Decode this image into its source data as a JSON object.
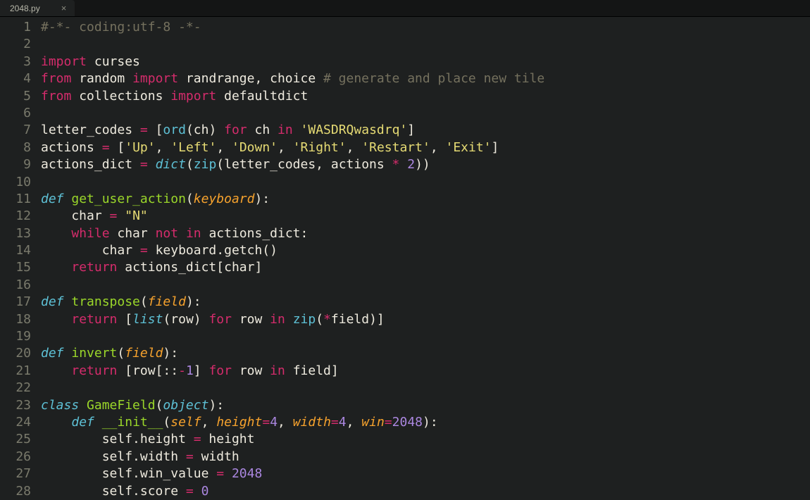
{
  "tab": {
    "filename": "2048.py",
    "close_glyph": "×"
  },
  "gutter": [
    "1",
    "2",
    "3",
    "4",
    "5",
    "6",
    "7",
    "8",
    "9",
    "10",
    "11",
    "12",
    "13",
    "14",
    "15",
    "16",
    "17",
    "18",
    "19",
    "20",
    "21",
    "22",
    "23",
    "24",
    "25",
    "26",
    "27",
    "28"
  ],
  "code": [
    [
      {
        "t": "#-*- coding:utf-8 -*-",
        "c": "c-comment"
      }
    ],
    [],
    [
      {
        "t": "import",
        "c": "c-keyword"
      },
      {
        "t": " curses",
        "c": "c-default"
      }
    ],
    [
      {
        "t": "from",
        "c": "c-keyword"
      },
      {
        "t": " random ",
        "c": "c-default"
      },
      {
        "t": "import",
        "c": "c-keyword"
      },
      {
        "t": " randrange, choice ",
        "c": "c-default"
      },
      {
        "t": "# generate and place new tile",
        "c": "c-comment"
      }
    ],
    [
      {
        "t": "from",
        "c": "c-keyword"
      },
      {
        "t": " collections ",
        "c": "c-default"
      },
      {
        "t": "import",
        "c": "c-keyword"
      },
      {
        "t": " defaultdict",
        "c": "c-default"
      }
    ],
    [],
    [
      {
        "t": "letter_codes ",
        "c": "c-default"
      },
      {
        "t": "=",
        "c": "c-op"
      },
      {
        "t": " [",
        "c": "c-default"
      },
      {
        "t": "ord",
        "c": "c-builtin"
      },
      {
        "t": "(ch) ",
        "c": "c-default"
      },
      {
        "t": "for",
        "c": "c-keyword"
      },
      {
        "t": " ch ",
        "c": "c-default"
      },
      {
        "t": "in",
        "c": "c-keyword"
      },
      {
        "t": " ",
        "c": "c-default"
      },
      {
        "t": "'WASDRQwasdrq'",
        "c": "c-string"
      },
      {
        "t": "]",
        "c": "c-default"
      }
    ],
    [
      {
        "t": "actions ",
        "c": "c-default"
      },
      {
        "t": "=",
        "c": "c-op"
      },
      {
        "t": " [",
        "c": "c-default"
      },
      {
        "t": "'Up'",
        "c": "c-string"
      },
      {
        "t": ", ",
        "c": "c-default"
      },
      {
        "t": "'Left'",
        "c": "c-string"
      },
      {
        "t": ", ",
        "c": "c-default"
      },
      {
        "t": "'Down'",
        "c": "c-string"
      },
      {
        "t": ", ",
        "c": "c-default"
      },
      {
        "t": "'Right'",
        "c": "c-string"
      },
      {
        "t": ", ",
        "c": "c-default"
      },
      {
        "t": "'Restart'",
        "c": "c-string"
      },
      {
        "t": ", ",
        "c": "c-default"
      },
      {
        "t": "'Exit'",
        "c": "c-string"
      },
      {
        "t": "]",
        "c": "c-default"
      }
    ],
    [
      {
        "t": "actions_dict ",
        "c": "c-default"
      },
      {
        "t": "=",
        "c": "c-op"
      },
      {
        "t": " ",
        "c": "c-default"
      },
      {
        "t": "dict",
        "c": "c-storage"
      },
      {
        "t": "(",
        "c": "c-default"
      },
      {
        "t": "zip",
        "c": "c-builtin"
      },
      {
        "t": "(letter_codes, actions ",
        "c": "c-default"
      },
      {
        "t": "*",
        "c": "c-op"
      },
      {
        "t": " ",
        "c": "c-default"
      },
      {
        "t": "2",
        "c": "c-number"
      },
      {
        "t": "))",
        "c": "c-default"
      }
    ],
    [],
    [
      {
        "t": "def",
        "c": "c-storage"
      },
      {
        "t": " ",
        "c": "c-default"
      },
      {
        "t": "get_user_action",
        "c": "c-name"
      },
      {
        "t": "(",
        "c": "c-default"
      },
      {
        "t": "keyboard",
        "c": "c-param"
      },
      {
        "t": "):",
        "c": "c-default"
      }
    ],
    [
      {
        "t": "    char ",
        "c": "c-default"
      },
      {
        "t": "=",
        "c": "c-op"
      },
      {
        "t": " ",
        "c": "c-default"
      },
      {
        "t": "\"N\"",
        "c": "c-string"
      }
    ],
    [
      {
        "t": "    ",
        "c": "c-default"
      },
      {
        "t": "while",
        "c": "c-keyword"
      },
      {
        "t": " char ",
        "c": "c-default"
      },
      {
        "t": "not",
        "c": "c-keyword"
      },
      {
        "t": " ",
        "c": "c-default"
      },
      {
        "t": "in",
        "c": "c-keyword"
      },
      {
        "t": " actions_dict:",
        "c": "c-default"
      }
    ],
    [
      {
        "t": "        char ",
        "c": "c-default"
      },
      {
        "t": "=",
        "c": "c-op"
      },
      {
        "t": " keyboard.getch()",
        "c": "c-default"
      }
    ],
    [
      {
        "t": "    ",
        "c": "c-default"
      },
      {
        "t": "return",
        "c": "c-keyword"
      },
      {
        "t": " actions_dict[char]",
        "c": "c-default"
      }
    ],
    [],
    [
      {
        "t": "def",
        "c": "c-storage"
      },
      {
        "t": " ",
        "c": "c-default"
      },
      {
        "t": "transpose",
        "c": "c-name"
      },
      {
        "t": "(",
        "c": "c-default"
      },
      {
        "t": "field",
        "c": "c-param"
      },
      {
        "t": "):",
        "c": "c-default"
      }
    ],
    [
      {
        "t": "    ",
        "c": "c-default"
      },
      {
        "t": "return",
        "c": "c-keyword"
      },
      {
        "t": " [",
        "c": "c-default"
      },
      {
        "t": "list",
        "c": "c-storage"
      },
      {
        "t": "(row) ",
        "c": "c-default"
      },
      {
        "t": "for",
        "c": "c-keyword"
      },
      {
        "t": " row ",
        "c": "c-default"
      },
      {
        "t": "in",
        "c": "c-keyword"
      },
      {
        "t": " ",
        "c": "c-default"
      },
      {
        "t": "zip",
        "c": "c-builtin"
      },
      {
        "t": "(",
        "c": "c-default"
      },
      {
        "t": "*",
        "c": "c-op"
      },
      {
        "t": "field)]",
        "c": "c-default"
      }
    ],
    [],
    [
      {
        "t": "def",
        "c": "c-storage"
      },
      {
        "t": " ",
        "c": "c-default"
      },
      {
        "t": "invert",
        "c": "c-name"
      },
      {
        "t": "(",
        "c": "c-default"
      },
      {
        "t": "field",
        "c": "c-param"
      },
      {
        "t": "):",
        "c": "c-default"
      }
    ],
    [
      {
        "t": "    ",
        "c": "c-default"
      },
      {
        "t": "return",
        "c": "c-keyword"
      },
      {
        "t": " [row[::",
        "c": "c-default"
      },
      {
        "t": "-",
        "c": "c-op"
      },
      {
        "t": "1",
        "c": "c-number"
      },
      {
        "t": "] ",
        "c": "c-default"
      },
      {
        "t": "for",
        "c": "c-keyword"
      },
      {
        "t": " row ",
        "c": "c-default"
      },
      {
        "t": "in",
        "c": "c-keyword"
      },
      {
        "t": " field]",
        "c": "c-default"
      }
    ],
    [],
    [
      {
        "t": "class",
        "c": "c-storage"
      },
      {
        "t": " ",
        "c": "c-default"
      },
      {
        "t": "GameField",
        "c": "c-name"
      },
      {
        "t": "(",
        "c": "c-default"
      },
      {
        "t": "object",
        "c": "c-storage"
      },
      {
        "t": "):",
        "c": "c-default"
      }
    ],
    [
      {
        "t": "    ",
        "c": "c-default"
      },
      {
        "t": "def",
        "c": "c-storage"
      },
      {
        "t": " ",
        "c": "c-default"
      },
      {
        "t": "__init__",
        "c": "c-name"
      },
      {
        "t": "(",
        "c": "c-default"
      },
      {
        "t": "self",
        "c": "c-param"
      },
      {
        "t": ", ",
        "c": "c-default"
      },
      {
        "t": "height",
        "c": "c-paramkw"
      },
      {
        "t": "=",
        "c": "c-op"
      },
      {
        "t": "4",
        "c": "c-number"
      },
      {
        "t": ", ",
        "c": "c-default"
      },
      {
        "t": "width",
        "c": "c-paramkw"
      },
      {
        "t": "=",
        "c": "c-op"
      },
      {
        "t": "4",
        "c": "c-number"
      },
      {
        "t": ", ",
        "c": "c-default"
      },
      {
        "t": "win",
        "c": "c-paramkw"
      },
      {
        "t": "=",
        "c": "c-op"
      },
      {
        "t": "2048",
        "c": "c-number"
      },
      {
        "t": "):",
        "c": "c-default"
      }
    ],
    [
      {
        "t": "        self.height ",
        "c": "c-default"
      },
      {
        "t": "=",
        "c": "c-op"
      },
      {
        "t": " height",
        "c": "c-default"
      }
    ],
    [
      {
        "t": "        self.width ",
        "c": "c-default"
      },
      {
        "t": "=",
        "c": "c-op"
      },
      {
        "t": " width",
        "c": "c-default"
      }
    ],
    [
      {
        "t": "        self.win_value ",
        "c": "c-default"
      },
      {
        "t": "=",
        "c": "c-op"
      },
      {
        "t": " ",
        "c": "c-default"
      },
      {
        "t": "2048",
        "c": "c-number"
      }
    ],
    [
      {
        "t": "        self.score ",
        "c": "c-default"
      },
      {
        "t": "=",
        "c": "c-op"
      },
      {
        "t": " ",
        "c": "c-default"
      },
      {
        "t": "0",
        "c": "c-number"
      }
    ]
  ]
}
